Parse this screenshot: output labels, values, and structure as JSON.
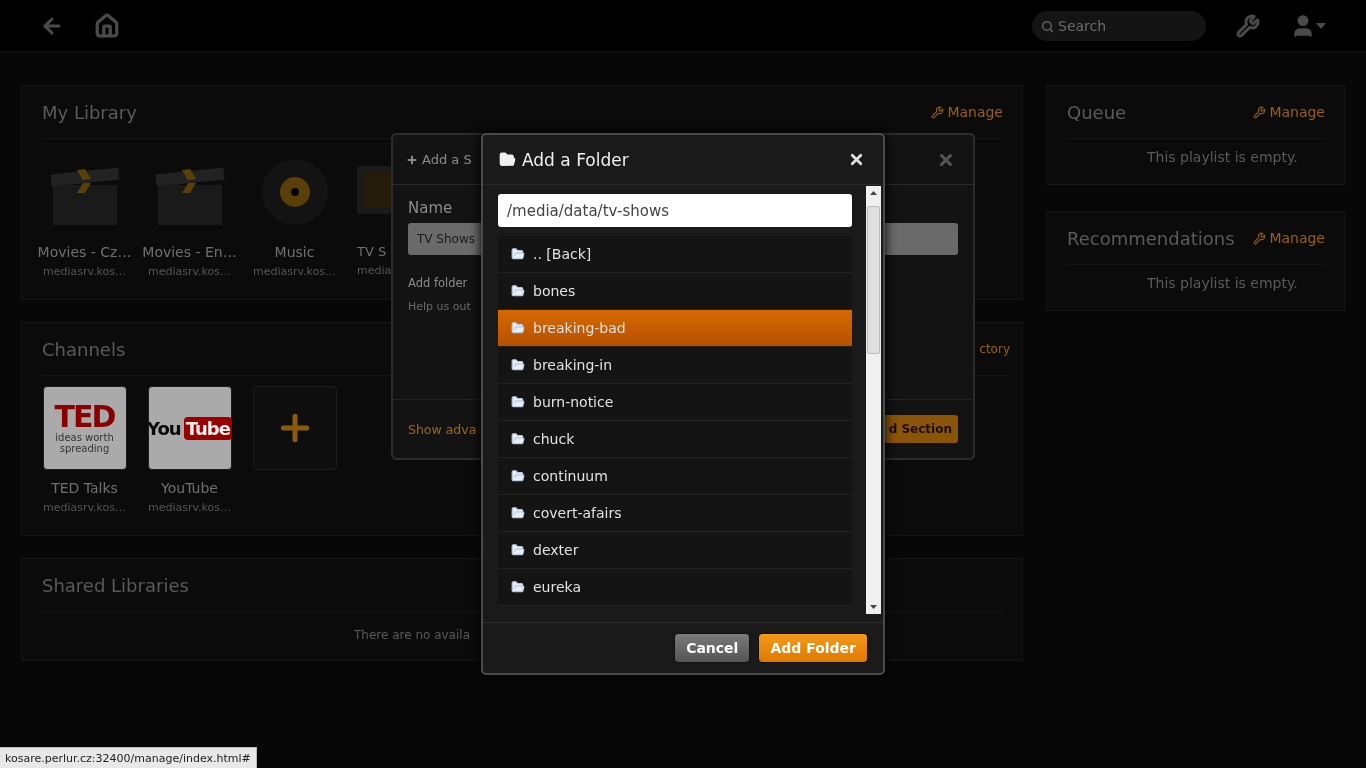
{
  "topbar": {
    "search": {
      "placeholder": "Search"
    }
  },
  "library": {
    "title": "My Library",
    "manage": "Manage",
    "items": [
      {
        "kind": "movie",
        "title": "Movies - Cz…",
        "server": "mediasrv.kos…"
      },
      {
        "kind": "movie",
        "title": "Movies - En…",
        "server": "mediasrv.kos…"
      },
      {
        "kind": "music",
        "title": "Music",
        "server": "mediasrv.kos…"
      },
      {
        "kind": "tv",
        "title": "TV S",
        "server": "media"
      }
    ]
  },
  "channels": {
    "title": "Channels",
    "link": "ctory",
    "items": [
      {
        "kind": "ted",
        "logo": "TED",
        "tagline": "ideas worth spreading",
        "title": "TED Talks",
        "server": "mediasrv.kos…"
      },
      {
        "kind": "youtube",
        "logo": "You",
        "logo_box": "Tube",
        "title": "YouTube",
        "server": "mediasrv.kos…"
      },
      {
        "kind": "add"
      }
    ]
  },
  "shared": {
    "title": "Shared Libraries",
    "empty": "There are no availa"
  },
  "queue": {
    "title": "Queue",
    "manage": "Manage",
    "empty": "This playlist is empty."
  },
  "recommendations": {
    "title": "Recommendations",
    "manage": "Manage",
    "empty": "This playlist is empty."
  },
  "section_dialog": {
    "title": "Add a S",
    "name_label": "Name",
    "name_value": "TV Shows",
    "folders_label": "Add folder",
    "help": "Help us out",
    "advanced_link": "Show adva",
    "submit": "d Section"
  },
  "folder_dialog": {
    "title": "Add a Folder",
    "path": "/media/data/tv-shows",
    "folders": [
      {
        "name": ".. [Back]",
        "selected": false
      },
      {
        "name": "bones",
        "selected": false
      },
      {
        "name": "breaking-bad",
        "selected": true
      },
      {
        "name": "breaking-in",
        "selected": false
      },
      {
        "name": "burn-notice",
        "selected": false
      },
      {
        "name": "chuck",
        "selected": false
      },
      {
        "name": "continuum",
        "selected": false
      },
      {
        "name": "covert-afairs",
        "selected": false
      },
      {
        "name": "dexter",
        "selected": false
      },
      {
        "name": "eureka",
        "selected": false
      }
    ],
    "cancel": "Cancel",
    "confirm": "Add Folder"
  },
  "status_bar": "kosare.perlur.cz:32400/manage/index.html#"
}
